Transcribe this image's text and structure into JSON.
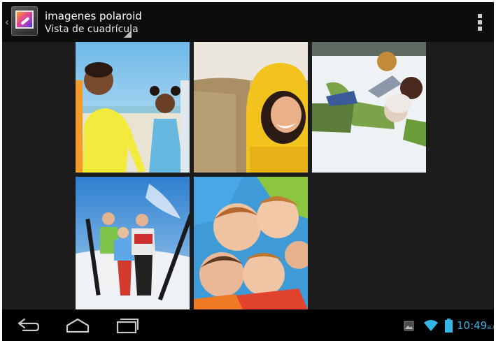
{
  "action_bar": {
    "title": "imagenes polaroid",
    "subtitle": "Vista de cuadrícula"
  },
  "grid": {
    "thumbnails": [
      {
        "label": "photo-1",
        "description_icon": "kids-beach-photo"
      },
      {
        "label": "photo-2",
        "description_icon": "girl-yellow-hood-photo"
      },
      {
        "label": "photo-3",
        "description_icon": "kids-snow-photo"
      },
      {
        "label": "photo-4",
        "description_icon": "ski-family-photo"
      },
      {
        "label": "photo-5",
        "description_icon": "kids-circle-photo"
      }
    ]
  },
  "status_bar": {
    "time": "10:49",
    "ampm": "a.m."
  },
  "colors": {
    "accent": "#33b5e5",
    "background": "#1c1c1c",
    "bar": "#0d0d0d"
  }
}
